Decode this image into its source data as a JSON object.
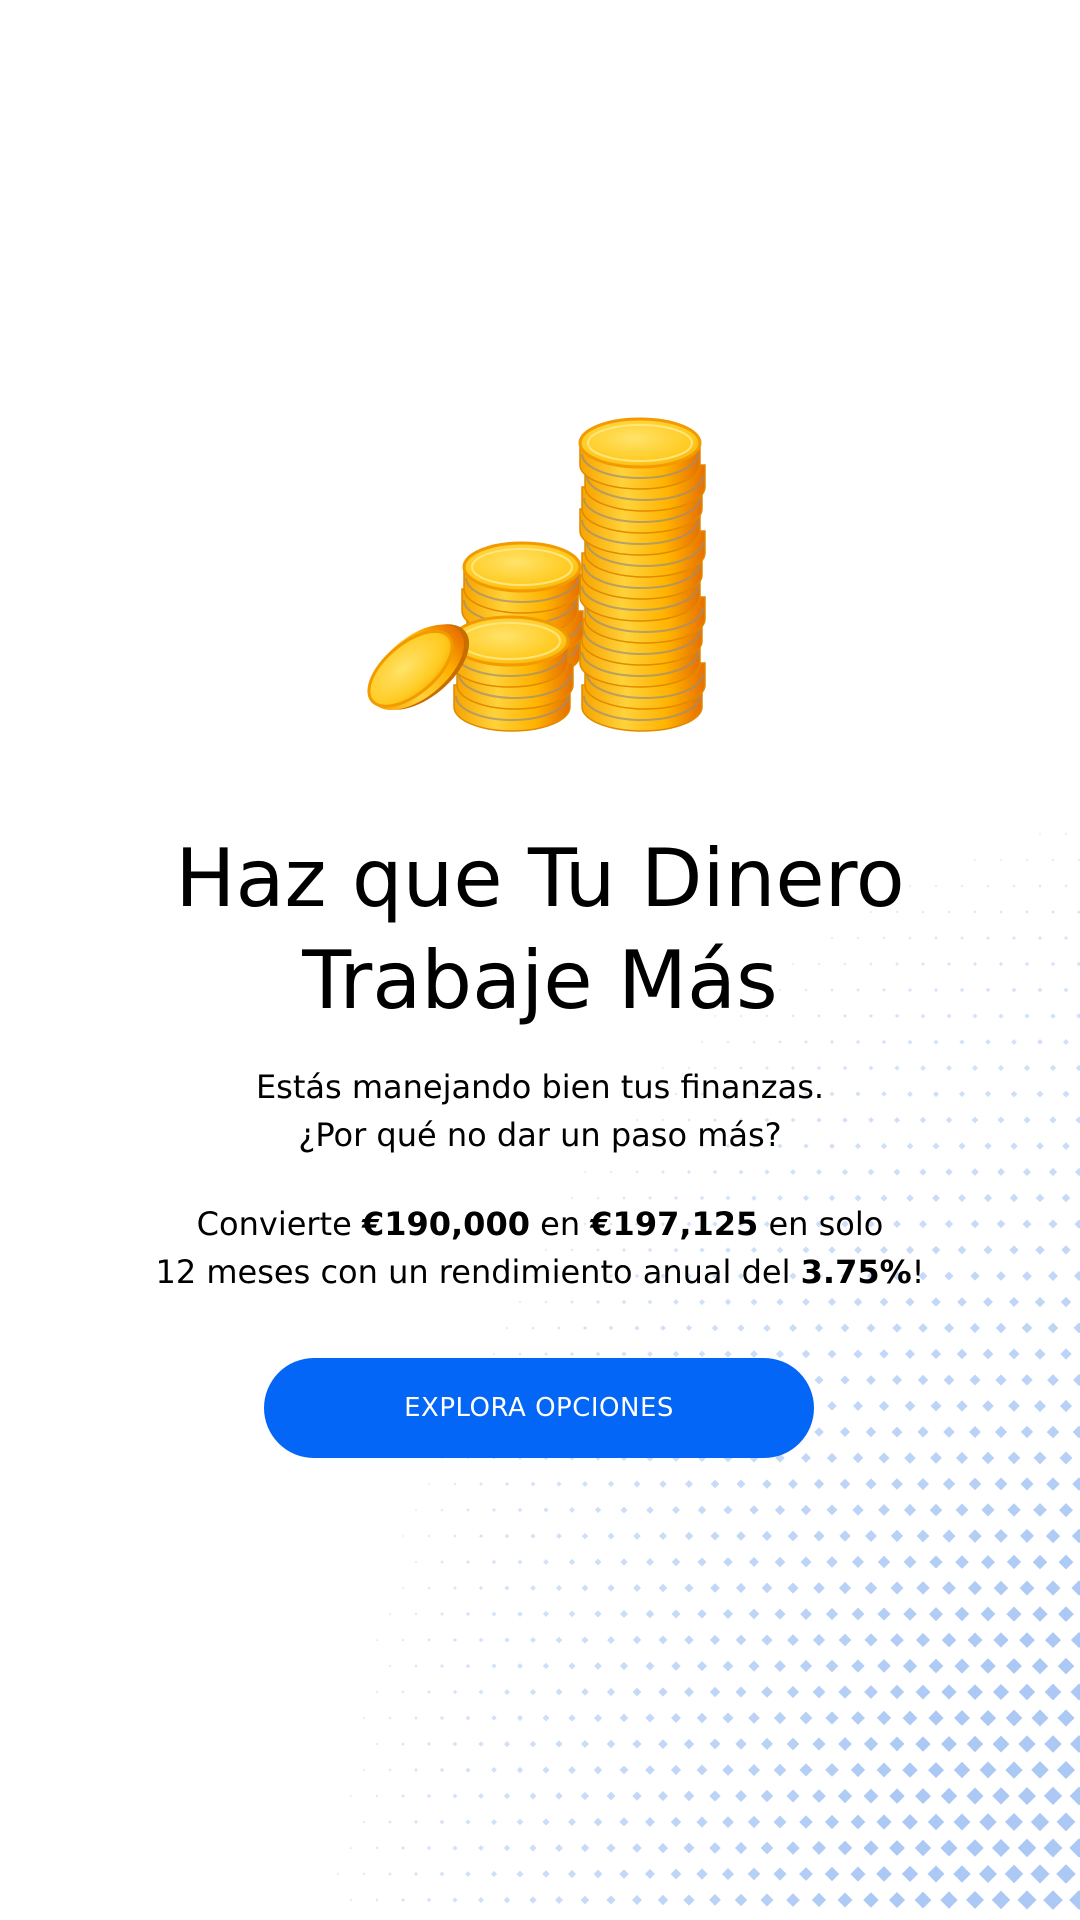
{
  "hero": {
    "image_icon": "coin-stack-icon",
    "title_line1": "Haz que Tu Dinero",
    "title_line2": "Trabaje Más",
    "subtitle_line1": "Estás manejando bien tus finanzas.",
    "subtitle_line2": "¿Por qué no dar un paso más?"
  },
  "offer": {
    "prefix": "Convierte ",
    "amount_from": "€190,000",
    "mid": " en ",
    "amount_to": "€197,125",
    "suffix_line1": " en solo",
    "line2_prefix": "12 meses con un rendimiento anual del ",
    "rate": "3.75%",
    "line2_suffix": "!"
  },
  "cta": {
    "label": "EXPLORA OPCIONES"
  },
  "colors": {
    "background": "#ffffff",
    "accent": "#0466f6",
    "dots": "#9ec0f3",
    "coin_gold": "#ffc21a",
    "coin_edge": "#f08a00"
  }
}
